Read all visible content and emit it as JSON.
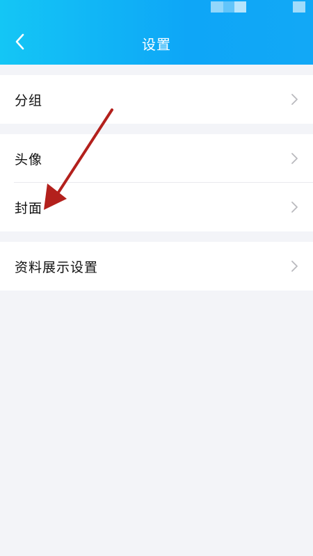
{
  "header": {
    "title": "设置"
  },
  "groups": [
    {
      "items": [
        {
          "label": "分组"
        }
      ]
    },
    {
      "items": [
        {
          "label": "头像"
        },
        {
          "label": "封面"
        }
      ]
    },
    {
      "items": [
        {
          "label": "资料展示设置"
        }
      ]
    }
  ],
  "colors": {
    "header_start": "#14c6f5",
    "header_end": "#0ea6f7",
    "background": "#f3f4f8",
    "annotation_arrow": "#b3201c"
  }
}
